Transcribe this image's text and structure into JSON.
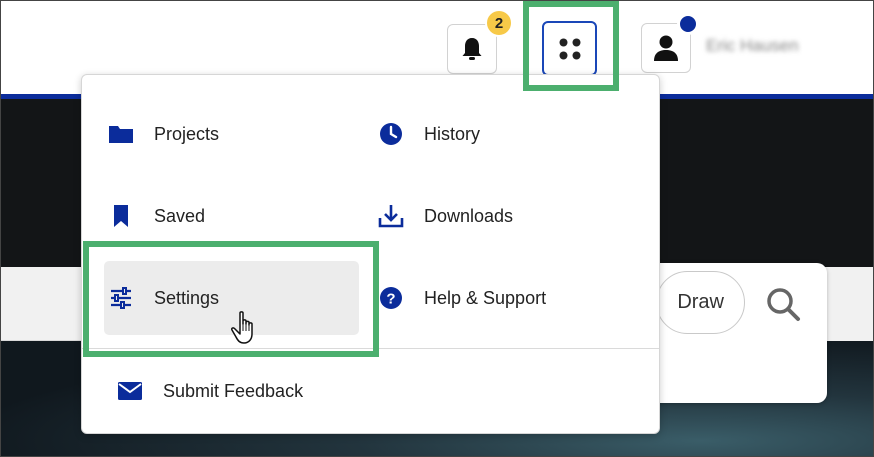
{
  "header": {
    "notifications_count": "2",
    "user_name": "Eric Hausen"
  },
  "menu": {
    "left_column": [
      {
        "label": "Projects",
        "icon": "folder-icon"
      },
      {
        "label": "Saved",
        "icon": "bookmark-icon"
      },
      {
        "label": "Settings",
        "icon": "sliders-icon"
      }
    ],
    "right_column": [
      {
        "label": "History",
        "icon": "clock-icon"
      },
      {
        "label": "Downloads",
        "icon": "download-icon"
      },
      {
        "label": "Help & Support",
        "icon": "help-icon"
      }
    ],
    "footer": {
      "label": "Submit Feedback",
      "icon": "envelope-icon"
    }
  },
  "search": {
    "draw_label": "Draw"
  },
  "colors": {
    "brand_blue": "#0b2c9b",
    "highlight_green": "#4caf6e",
    "badge_yellow": "#f7c948"
  }
}
